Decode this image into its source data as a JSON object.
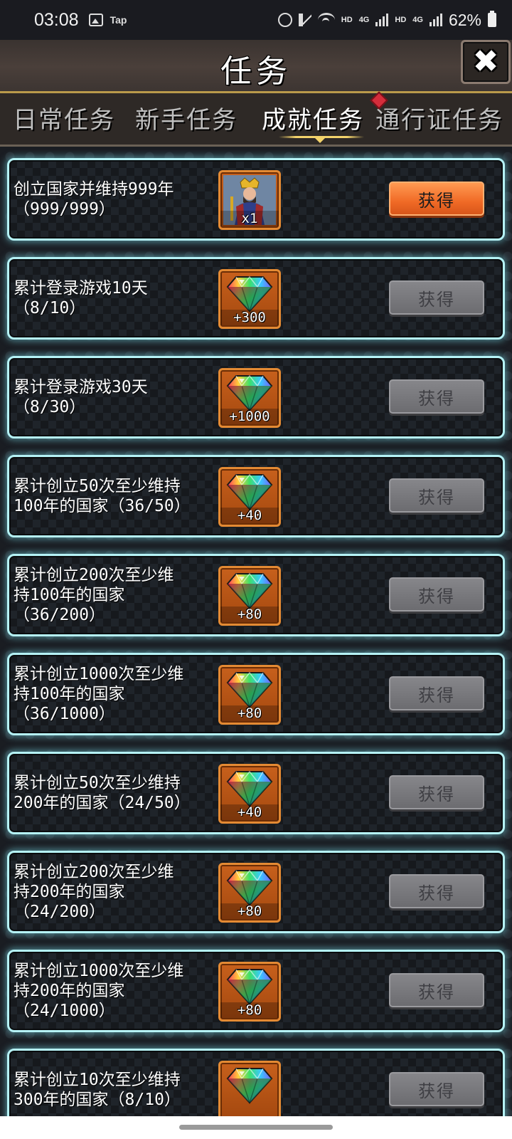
{
  "status_bar": {
    "time": "03:08",
    "app_label": "Tap",
    "net_labels": [
      "HD",
      "4G",
      "HD",
      "4G"
    ],
    "battery": "62%"
  },
  "header": {
    "title": "任务",
    "close_icon": "close-x-icon"
  },
  "tabs": [
    {
      "label": "日常任务",
      "active": false
    },
    {
      "label": "新手任务",
      "active": false
    },
    {
      "label": "成就任务",
      "active": true
    },
    {
      "label": "通行证任务",
      "active": false,
      "has_badge": true
    }
  ],
  "tasks": [
    {
      "text": "创立国家并维持999年\n（999/999）",
      "reward_type": "character",
      "reward": "x1",
      "button": "获得",
      "claimable": true
    },
    {
      "text": "累计登录游戏10天\n（8/10）",
      "reward_type": "gem",
      "reward": "+300",
      "button": "获得",
      "claimable": false
    },
    {
      "text": "累计登录游戏30天\n（8/30）",
      "reward_type": "gem",
      "reward": "+1000",
      "button": "获得",
      "claimable": false
    },
    {
      "text": "累计创立50次至少维持\n100年的国家（36/50）",
      "reward_type": "gem",
      "reward": "+40",
      "button": "获得",
      "claimable": false
    },
    {
      "text": "累计创立200次至少维\n持100年的国家\n（36/200）",
      "reward_type": "gem",
      "reward": "+80",
      "button": "获得",
      "claimable": false
    },
    {
      "text": "累计创立1000次至少维\n持100年的国家\n（36/1000）",
      "reward_type": "gem",
      "reward": "+80",
      "button": "获得",
      "claimable": false
    },
    {
      "text": "累计创立50次至少维持\n200年的国家（24/50）",
      "reward_type": "gem",
      "reward": "+40",
      "button": "获得",
      "claimable": false
    },
    {
      "text": "累计创立200次至少维\n持200年的国家\n（24/200）",
      "reward_type": "gem",
      "reward": "+80",
      "button": "获得",
      "claimable": false
    },
    {
      "text": "累计创立1000次至少维\n持200年的国家\n（24/1000）",
      "reward_type": "gem",
      "reward": "+80",
      "button": "获得",
      "claimable": false
    },
    {
      "text": "累计创立10次至少维持\n300年的国家（8/10）",
      "reward_type": "gem",
      "reward": "",
      "button": "获得",
      "claimable": false
    }
  ],
  "colors": {
    "card_border": "#b5f2f5",
    "claim_enabled": "#f06a26",
    "claim_disabled": "#7a7a7e",
    "reward_frame": "#c7601c"
  }
}
